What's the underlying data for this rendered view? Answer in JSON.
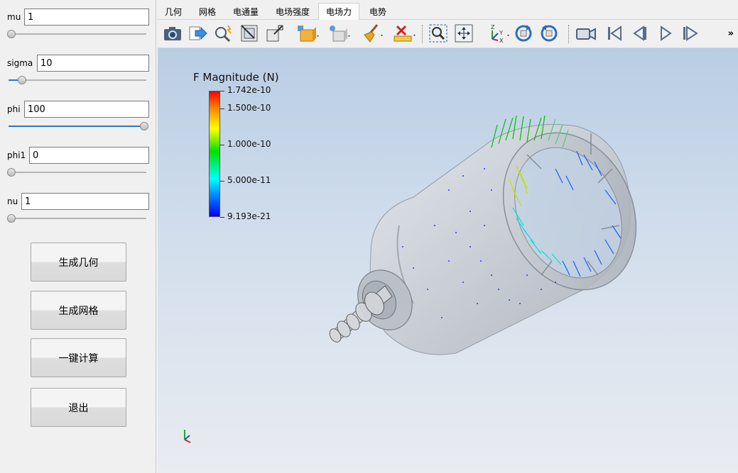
{
  "params": [
    {
      "label": "mu",
      "value": "1",
      "slider": 0.0
    },
    {
      "label": "sigma",
      "value": "10",
      "slider": 0.1
    },
    {
      "label": "phi",
      "value": "100",
      "slider": 1.0
    },
    {
      "label": "phi1",
      "value": "0",
      "slider": 0.0
    },
    {
      "label": "nu",
      "value": "1",
      "slider": 0.0
    }
  ],
  "buttons": {
    "generate_geometry": "生成几何",
    "generate_mesh": "生成网格",
    "one_click_compute": "一键计算",
    "exit": "退出"
  },
  "tabs": [
    "几何",
    "网格",
    "电通量",
    "电场强度",
    "电场力",
    "电势"
  ],
  "active_tab": "电场力",
  "toolbar": {
    "items": [
      "camera-icon",
      "export-icon",
      "magic-zoom-icon",
      "reset-view-icon",
      "zoom-box-icon",
      "representation-icon",
      "light-icon",
      "clear-icon",
      "measure-icon",
      "zoom-to-box-icon",
      "pan-icon",
      "axes-orientation-icon",
      "rotate-cw-icon",
      "rotate-ccw-icon",
      "video-camera-icon",
      "first-frame-icon",
      "previous-frame-icon",
      "play-icon",
      "last-frame-icon"
    ],
    "more": "»"
  },
  "legend": {
    "title": "F Magnitude (N)",
    "labels": [
      "1.742e-10",
      "1.500e-10",
      "1.000e-10",
      "5.000e-11",
      "9.193e-21"
    ]
  },
  "axes": {
    "x": "X",
    "y": "Y",
    "z": "Z"
  },
  "colors": {
    "accent": "#2a78c8",
    "panel_bg": "#f0f0f0",
    "viewport_top": "#b9cde4",
    "viewport_bottom": "#e9ecf1"
  }
}
